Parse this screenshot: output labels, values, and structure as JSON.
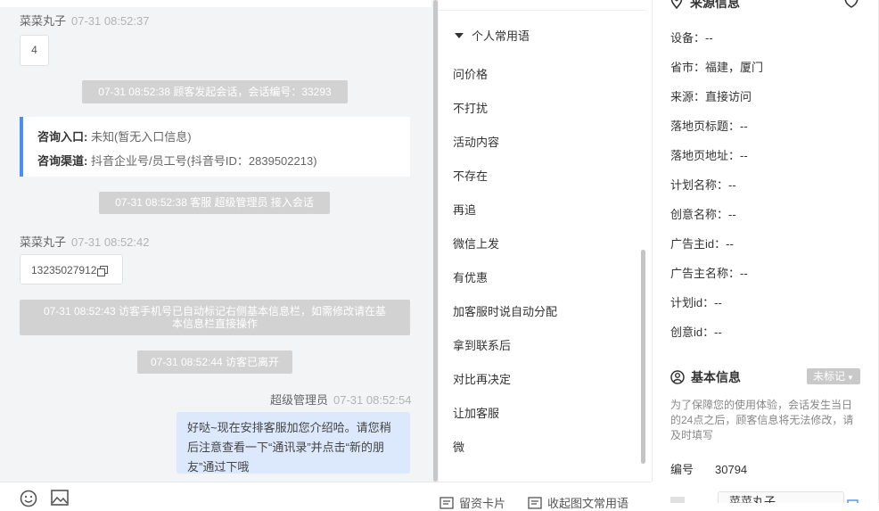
{
  "chat": {
    "visitor_name": "菜菜丸子",
    "msg1_time": "07-31 08:52:37",
    "msg1_text": "4",
    "sys_session_start": "07-31 08:52:38 顾客发起会话，会话编号：33293",
    "consult_entry_label": "咨询入口:",
    "consult_entry_value": "未知(暂无入口信息)",
    "consult_channel_label": "咨询渠道:",
    "consult_channel_value": "抖音企业号/员工号(抖音号ID：2839502213)",
    "sys_agent_join": "07-31 08:52:38 客服 超级管理员 接入会话",
    "msg2_time": "07-31 08:52:42",
    "msg2_text": "13235027912",
    "sys_phone_line1": "07-31 08:52:43 访客手机号已自动标记右侧基本信息栏，如需修改请在基",
    "sys_phone_line2": "本信息栏直接操作",
    "sys_visitor_left": "07-31 08:52:44 访客已离开",
    "agent_name": "超级管理员",
    "agent_time": "07-31 08:52:54",
    "agent_line1": "好哒~现在安排客服加您介绍哈。请您稍",
    "agent_line2": "后注意查看一下“通讯录”并点击“新的朋",
    "agent_line3": "友”通过下哦"
  },
  "footer": {
    "card_label": "留资卡片",
    "collapse_label": "收起图文常用语"
  },
  "phrases": {
    "title": "个人常用语",
    "items": [
      "问价格",
      "不打扰",
      "活动内容",
      "不存在",
      "再追",
      "微信上发",
      "有优惠",
      "加客服时说自动分配",
      "拿到联系后",
      "对比再决定",
      "让加客服",
      "微"
    ]
  },
  "info": {
    "source_title": "来源信息",
    "rows": [
      {
        "label": "设备：",
        "value": "--"
      },
      {
        "label": "省市：",
        "value": "福建，厦门"
      },
      {
        "label": "来源：",
        "value": "直接访问"
      },
      {
        "label": "落地页标题：",
        "value": "--"
      },
      {
        "label": "落地页地址：",
        "value": "--"
      },
      {
        "label": "计划名称：",
        "value": "--"
      },
      {
        "label": "创意名称：",
        "value": "--"
      },
      {
        "label": "广告主id：",
        "value": "--"
      },
      {
        "label": "广告主名称：",
        "value": "--"
      },
      {
        "label": "计划id：",
        "value": "--"
      },
      {
        "label": "创意id：",
        "value": "--"
      }
    ],
    "basic_title": "基本信息",
    "tag_label": "未标记",
    "notice": "为了保障您的使用体验，会话发生当日的24点之后，顾客信息将无法修改，请及时填写",
    "id_label": "编号",
    "id_value": "30794",
    "name_value": "菜菜丸子"
  },
  "colors": {
    "accent": "#4b8ef7",
    "agent_bubble": "#dce8fb",
    "system_pill": "#d2d2d2",
    "chat_bg": "#f3f4f5"
  }
}
